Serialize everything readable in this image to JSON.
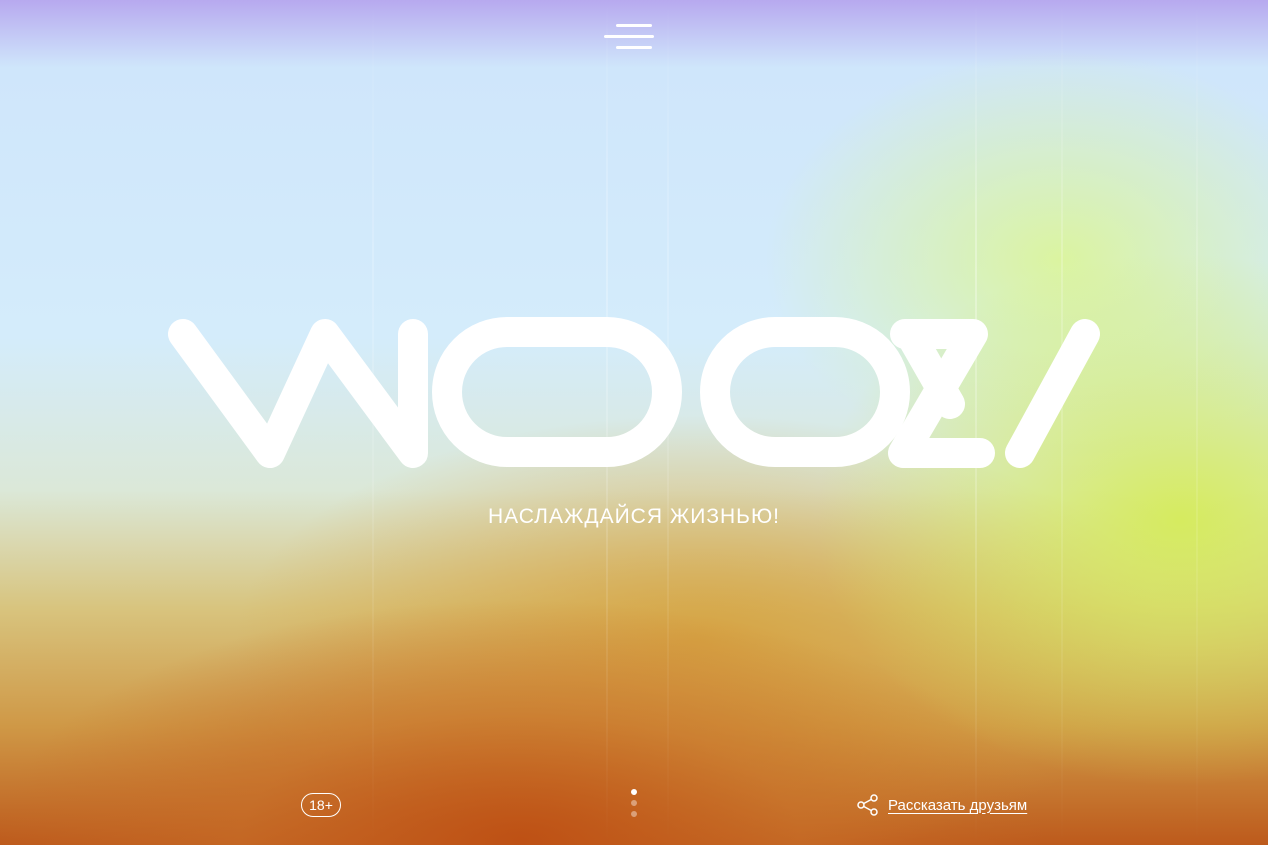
{
  "header": {
    "menu_icon": "hamburger-menu-icon"
  },
  "hero": {
    "logo_text": "WOOZY",
    "tagline": "НАСЛАЖДАЙСЯ ЖИЗНЬЮ!"
  },
  "footer": {
    "age_rating": "18+",
    "pager": {
      "total": 3,
      "active_index": 0
    },
    "share": {
      "icon": "share-icon",
      "label": "Рассказать друзьям"
    }
  },
  "colors": {
    "foreground": "#ffffff",
    "sky_blue": "#d4ecfb",
    "lime": "#d6ec5a",
    "orange": "#bd5a1c",
    "violet": "#b7a9ef"
  }
}
